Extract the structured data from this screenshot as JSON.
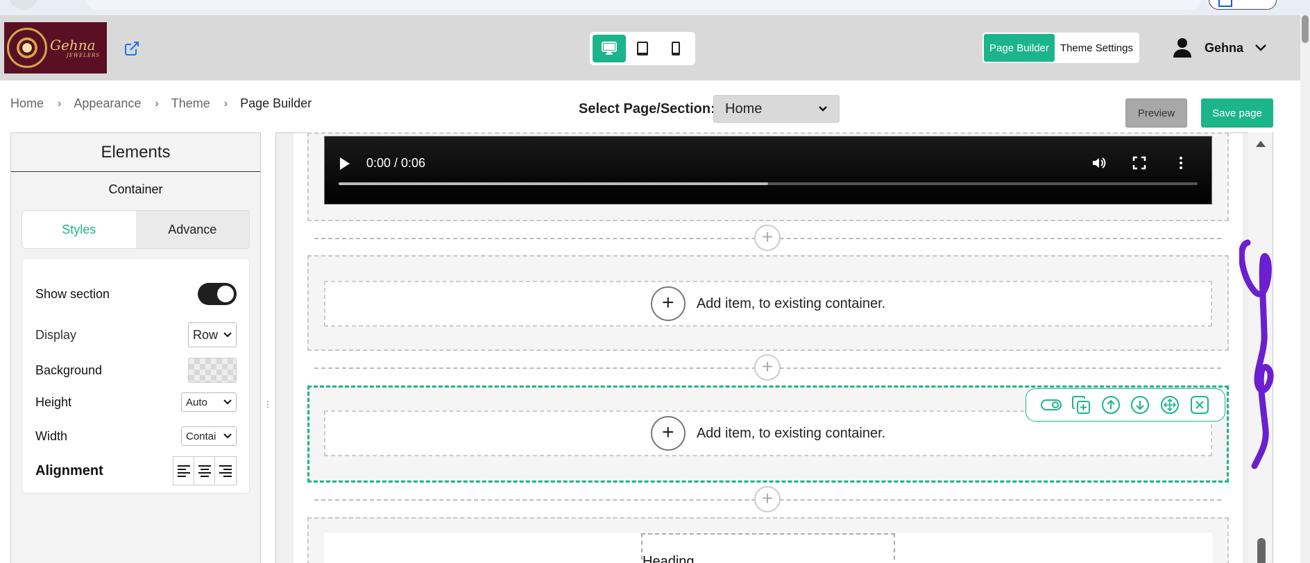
{
  "header": {
    "logo": {
      "brand": "Gehna",
      "tagline": "JEWELERS"
    },
    "device_modes": [
      "desktop-icon",
      "tablet-icon",
      "mobile-icon"
    ],
    "active_device": "desktop",
    "mode_tabs": {
      "page_builder": "Page Builder",
      "theme_settings": "Theme Settings"
    },
    "user": {
      "name": "Gehna"
    }
  },
  "breadcrumb": {
    "home": "Home",
    "appearance": "Appearance",
    "theme": "Theme",
    "current": "Page Builder"
  },
  "page_select": {
    "label": "Select Page/Section:",
    "value": "Home"
  },
  "actions": {
    "preview": "Preview",
    "save": "Save page"
  },
  "panel": {
    "title": "Elements",
    "subtitle": "Container",
    "tabs": {
      "styles": "Styles",
      "advance": "Advance"
    },
    "fields": {
      "show_section": {
        "label": "Show section",
        "value": true
      },
      "display": {
        "label": "Display",
        "value": "Row"
      },
      "background": {
        "label": "Background"
      },
      "height": {
        "label": "Height",
        "value": "Auto"
      },
      "width": {
        "label": "Width",
        "value": "Contai"
      },
      "alignment": {
        "label": "Alignment"
      }
    }
  },
  "canvas": {
    "video": {
      "time": "0:00 / 0:06",
      "progress": 0.5
    },
    "add_item_text": "Add item, to existing container.",
    "heading_text": "Heading"
  },
  "colors": {
    "accent": "#1cb48b",
    "header_bg": "#d9d9d9",
    "logo_bg": "#5a1024",
    "scribble": "#6a1fd0"
  }
}
